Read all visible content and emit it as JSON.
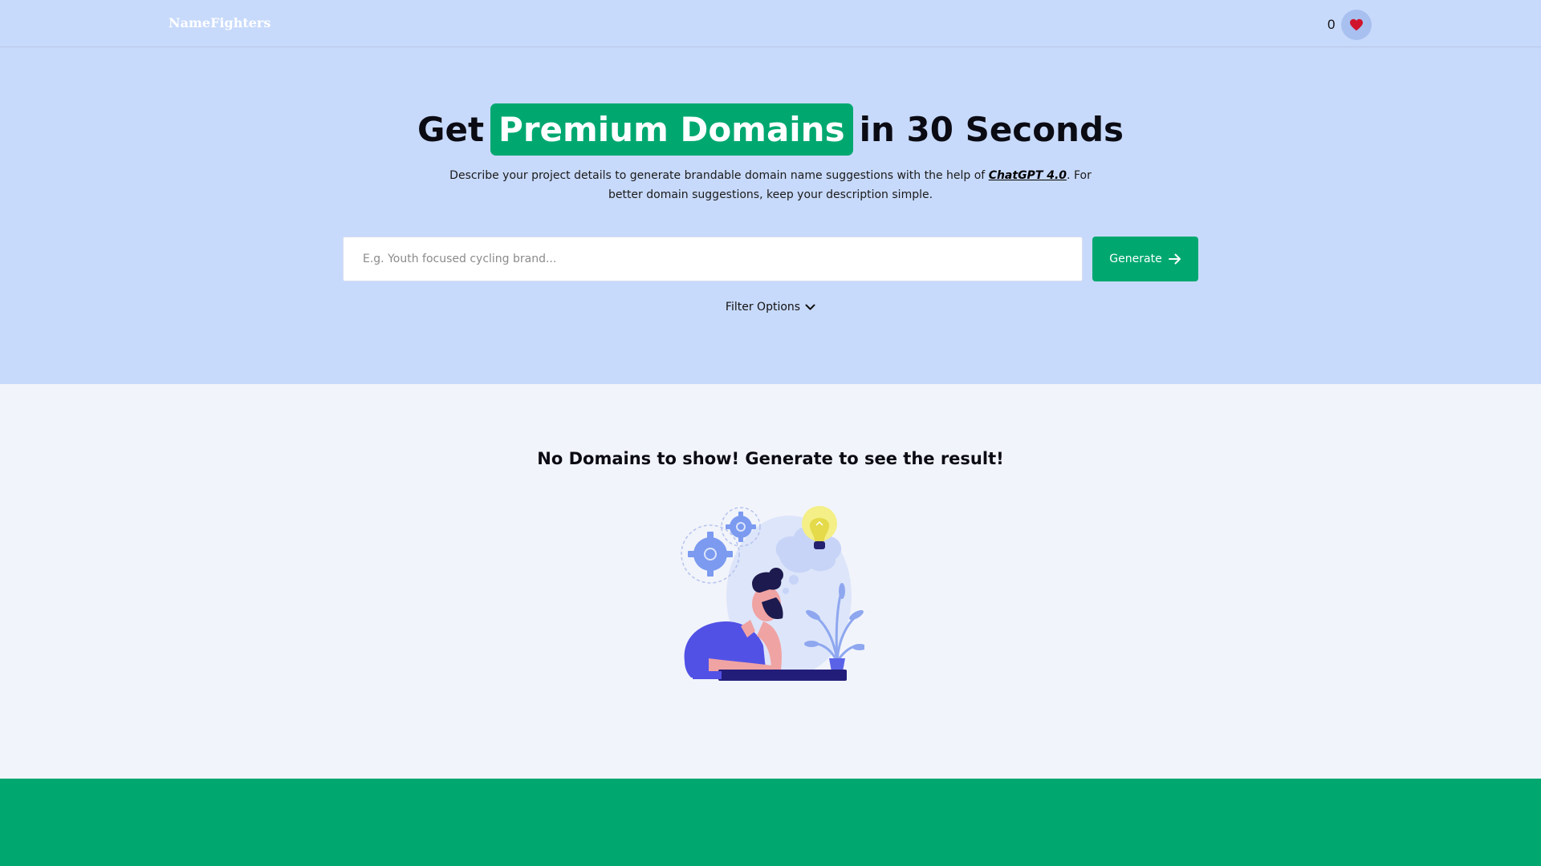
{
  "header": {
    "logo": "NameFighters",
    "favorites_count": "0",
    "favorites_icon": "heart-icon"
  },
  "hero": {
    "headline_before": "Get",
    "headline_highlight": "Premium Domains",
    "headline_after": "in 30 Seconds",
    "description_before": "Describe your project details to generate brandable domain name suggestions with the help of",
    "description_link": "ChatGPT 4.0",
    "description_after": ". For better domain suggestions, keep your description simple.",
    "search": {
      "placeholder": "E.g. Youth focused cycling brand...",
      "value": ""
    },
    "generate_label": "Generate",
    "generate_icon": "arrow-right-icon",
    "filter_label": "Filter Options",
    "filter_icon": "chevron-down-icon"
  },
  "results": {
    "empty_message": "No Domains to show! Generate to see the result!",
    "illustration": "person-thinking-illustration"
  },
  "colors": {
    "hero_bg": "#c8dafb",
    "accent_green": "#00a870",
    "page_bg": "#f2f4fb",
    "heart_red": "#d0142c"
  }
}
